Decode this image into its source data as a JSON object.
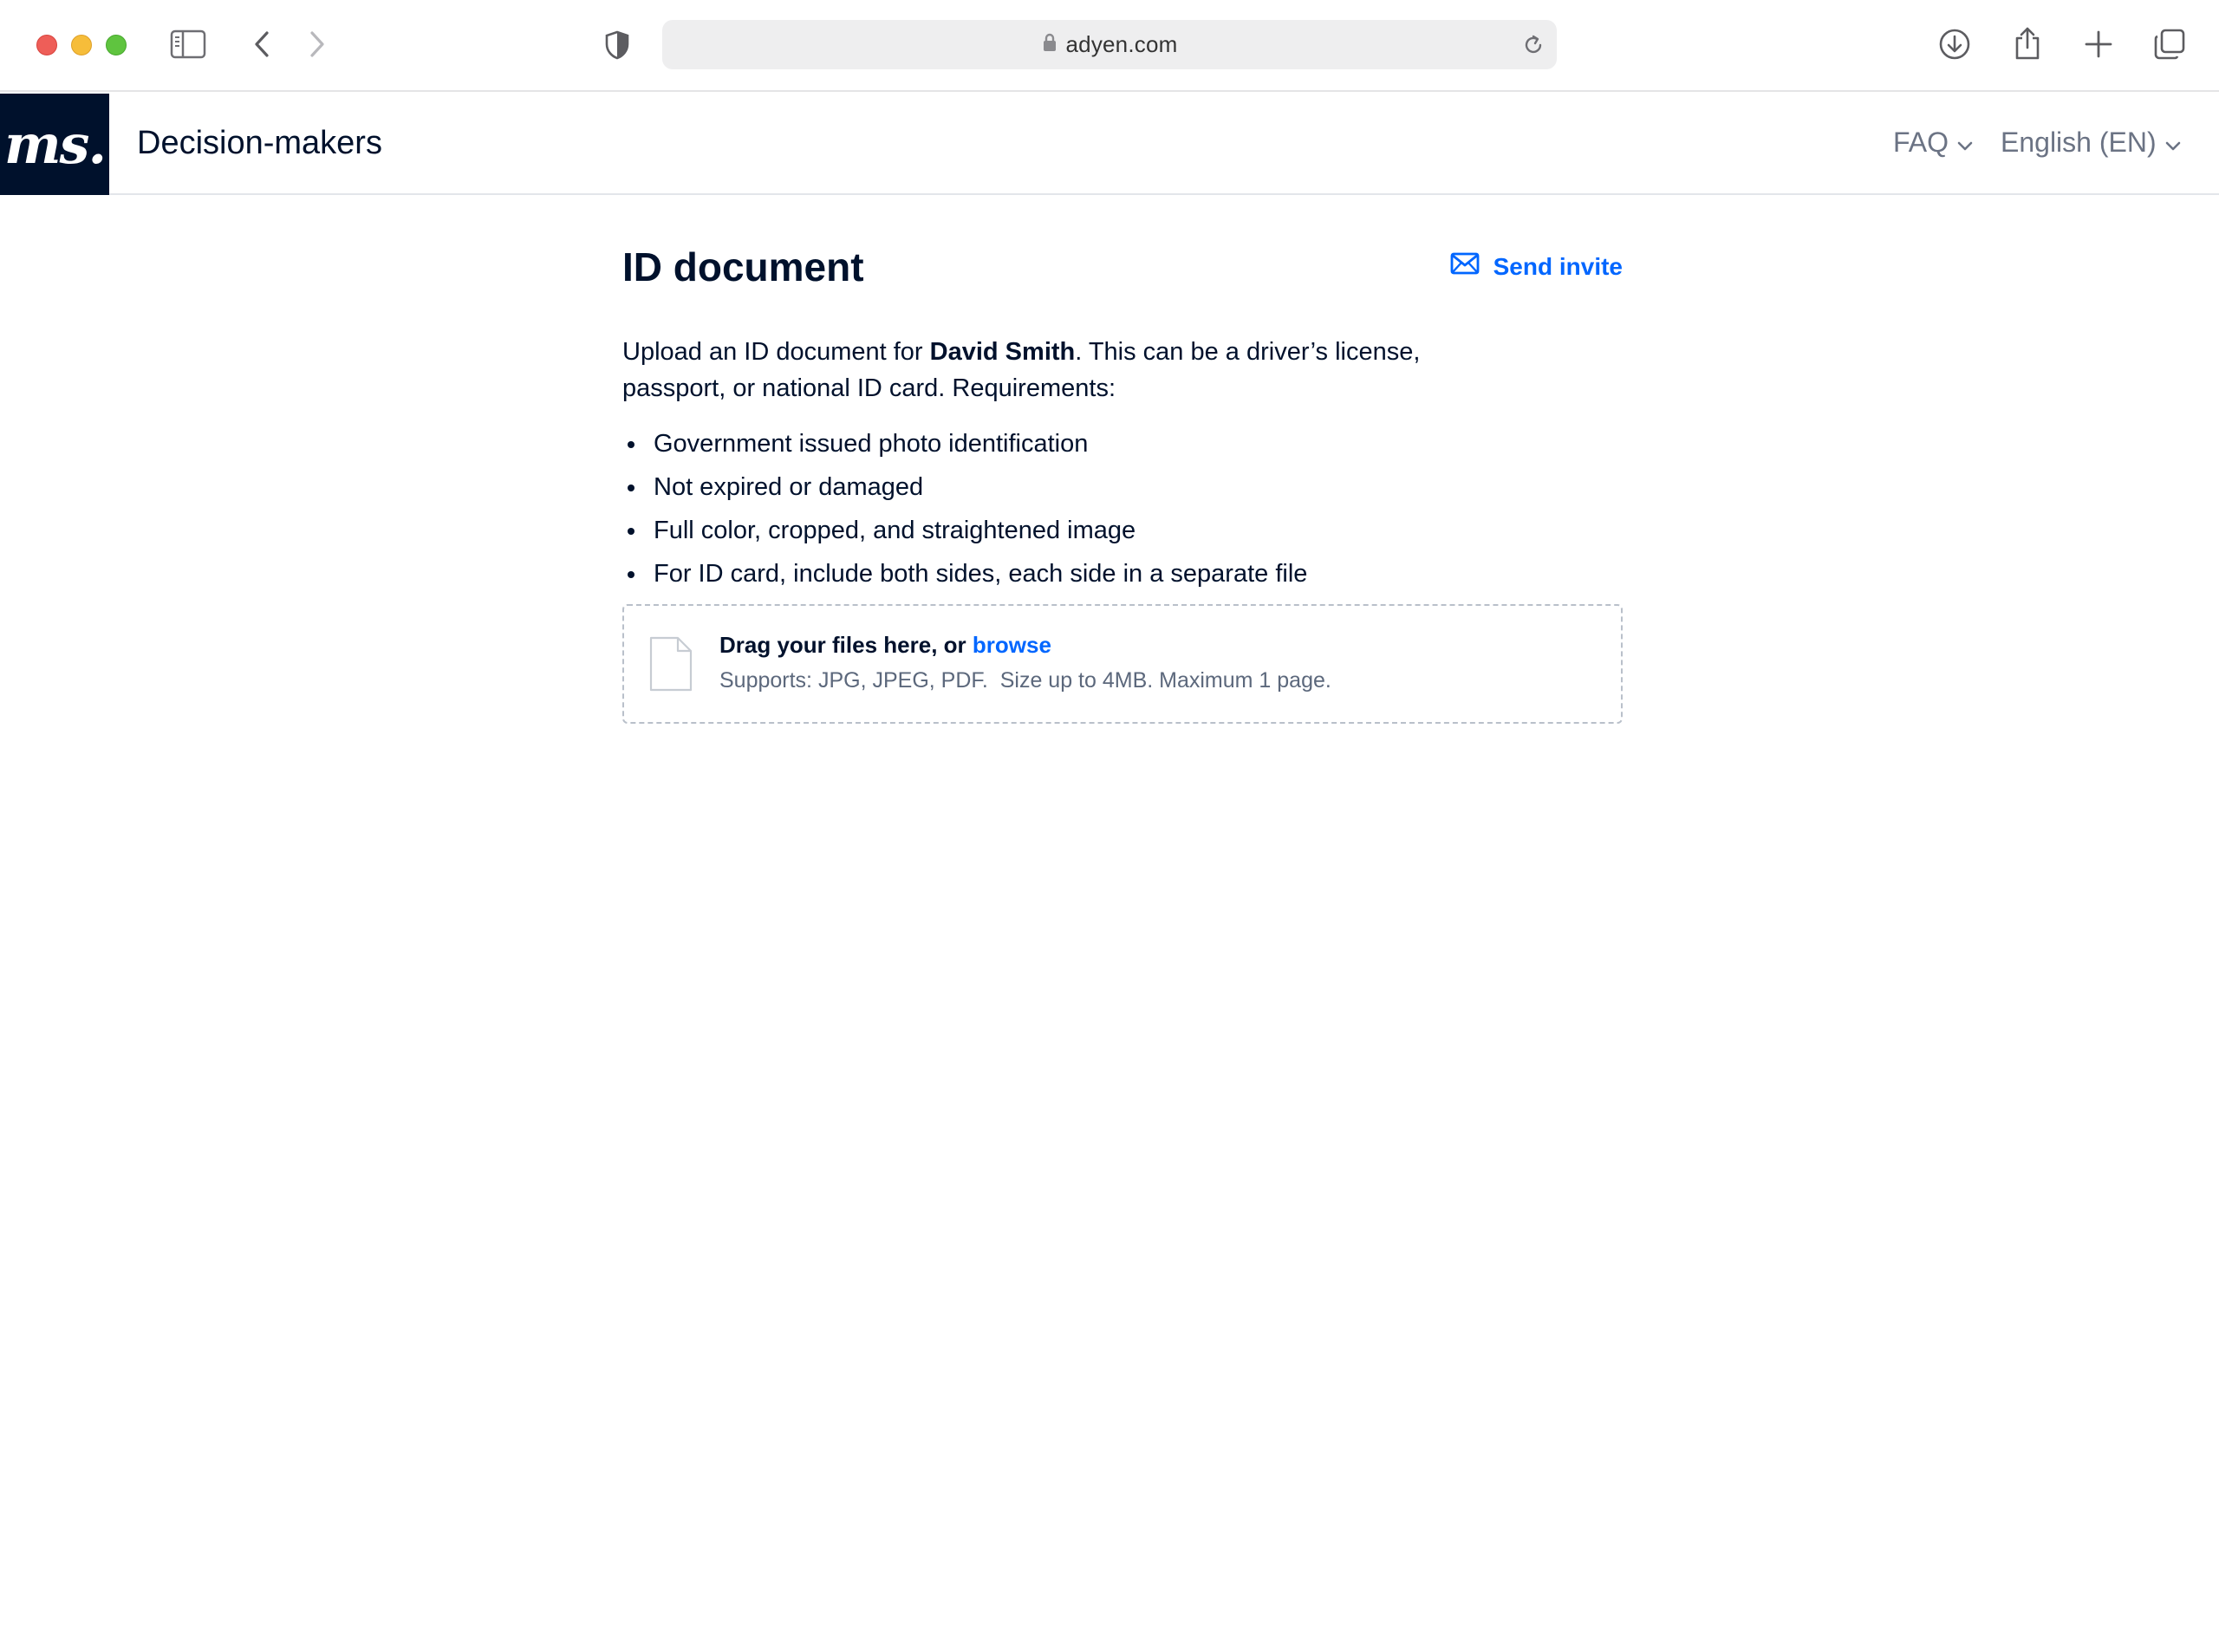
{
  "browser": {
    "url": "adyen.com",
    "icons": [
      "sidebar-icon",
      "back-icon",
      "forward-icon",
      "shield-icon",
      "lock-icon",
      "reload-icon",
      "download-icon",
      "share-icon",
      "new-tab-icon",
      "tabs-overview-icon"
    ]
  },
  "header": {
    "logo_text": "ms.",
    "title": "Decision-makers",
    "faq_label": "FAQ",
    "language_label": "English (EN)"
  },
  "main": {
    "title": "ID document",
    "send_invite_label": "Send invite",
    "intro_before": "Upload an ID document for ",
    "intro_name": "David Smith",
    "intro_after": ". This can be a driver’s license, passport, or national ID card. Requirements:",
    "requirements": [
      "Government issued photo identification",
      "Not expired or damaged",
      "Full color, cropped, and straightened image",
      "For ID card, include both sides, each side in a separate file"
    ],
    "dropzone": {
      "title_prefix": "Drag your files here, or ",
      "browse_label": "browse",
      "supports_text": "Supports: JPG, JPEG, PDF.  Size up to 4MB. Maximum 1 page."
    }
  },
  "colors": {
    "brand_dark": "#00112c",
    "link_blue": "#0066ff"
  }
}
